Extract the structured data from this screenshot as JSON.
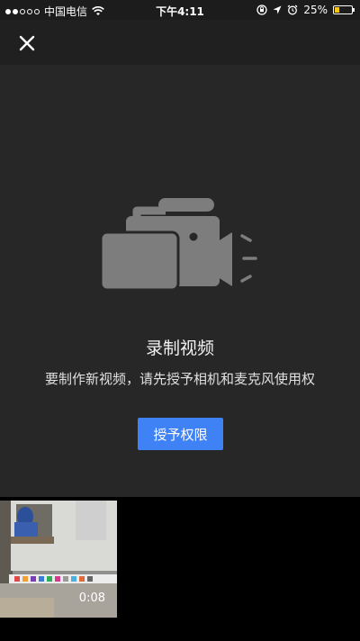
{
  "status_bar": {
    "carrier": "中国电信",
    "time": "下午4:11",
    "battery_percent": "25%",
    "battery_level": 0.25,
    "icons": [
      "signal-dots-icon",
      "wifi-icon",
      "orientation-lock-icon",
      "location-arrow-icon",
      "alarm-icon",
      "battery-icon"
    ]
  },
  "header": {
    "close_icon": "close-icon"
  },
  "main": {
    "illustration_icon": "video-camera-icon",
    "title": "录制视频",
    "description": "要制作新视频，请先授予相机和麦克风使用权",
    "grant_button_label": "授予权限"
  },
  "gallery": {
    "items": [
      {
        "duration": "0:08"
      }
    ]
  },
  "colors": {
    "status_bg": "#1c1c1c",
    "header_bg": "#202020",
    "panel_bg": "#272727",
    "button_bg": "#3f82f6",
    "icon_gray": "#7d7d7d",
    "battery_fill": "#f5c518"
  }
}
